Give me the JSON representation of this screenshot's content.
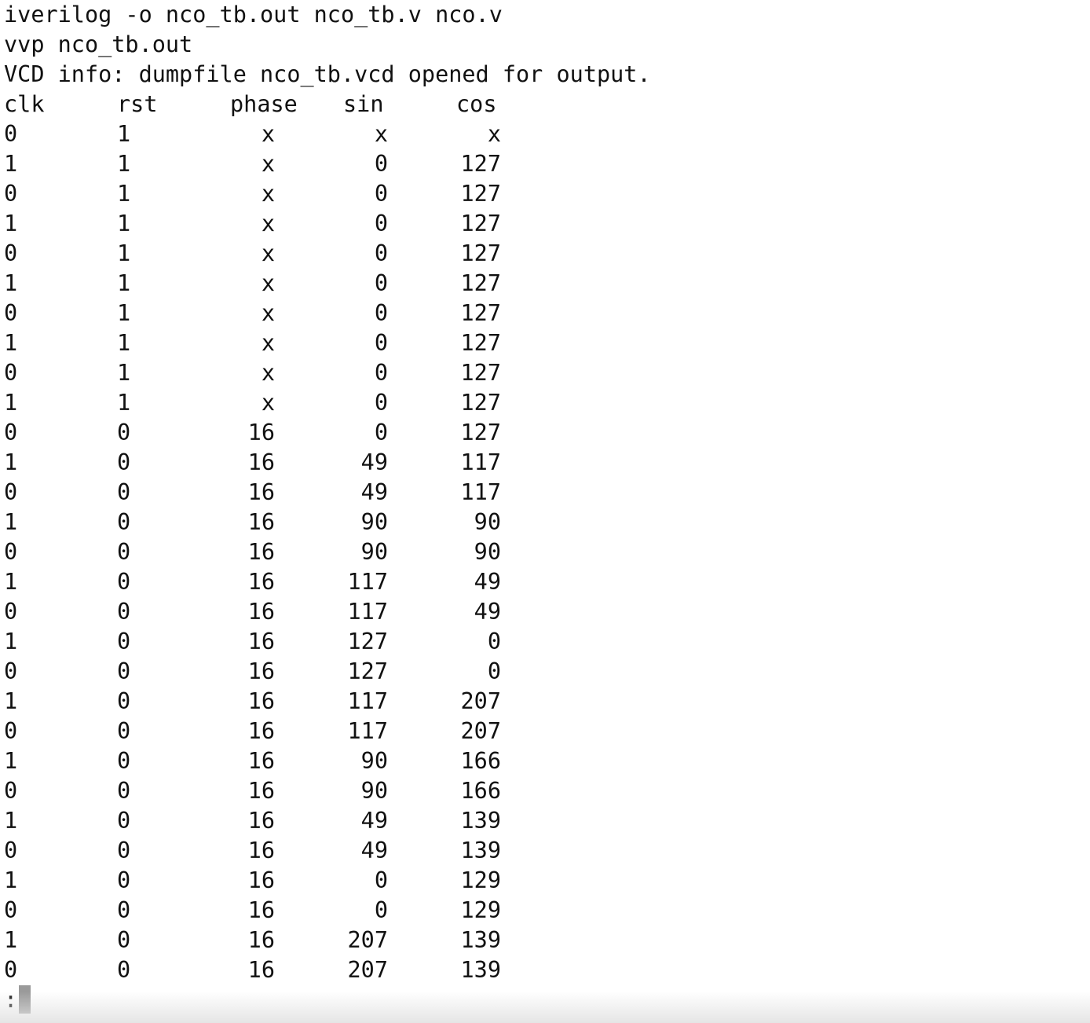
{
  "terminal": {
    "command_lines": [
      "iverilog -o nco_tb.out nco_tb.v nco.v",
      "vvp nco_tb.out",
      "VCD info: dumpfile nco_tb.vcd opened for output."
    ],
    "table": {
      "headers": [
        "clk",
        "rst",
        "phase",
        "sin",
        "cos"
      ],
      "rows": [
        [
          "0",
          "1",
          "x",
          "x",
          "x"
        ],
        [
          "1",
          "1",
          "x",
          "0",
          "127"
        ],
        [
          "0",
          "1",
          "x",
          "0",
          "127"
        ],
        [
          "1",
          "1",
          "x",
          "0",
          "127"
        ],
        [
          "0",
          "1",
          "x",
          "0",
          "127"
        ],
        [
          "1",
          "1",
          "x",
          "0",
          "127"
        ],
        [
          "0",
          "1",
          "x",
          "0",
          "127"
        ],
        [
          "1",
          "1",
          "x",
          "0",
          "127"
        ],
        [
          "0",
          "1",
          "x",
          "0",
          "127"
        ],
        [
          "1",
          "1",
          "x",
          "0",
          "127"
        ],
        [
          "0",
          "0",
          "16",
          "0",
          "127"
        ],
        [
          "1",
          "0",
          "16",
          "49",
          "117"
        ],
        [
          "0",
          "0",
          "16",
          "49",
          "117"
        ],
        [
          "1",
          "0",
          "16",
          "90",
          "90"
        ],
        [
          "0",
          "0",
          "16",
          "90",
          "90"
        ],
        [
          "1",
          "0",
          "16",
          "117",
          "49"
        ],
        [
          "0",
          "0",
          "16",
          "117",
          "49"
        ],
        [
          "1",
          "0",
          "16",
          "127",
          "0"
        ],
        [
          "0",
          "0",
          "16",
          "127",
          "0"
        ],
        [
          "1",
          "0",
          "16",
          "117",
          "207"
        ],
        [
          "0",
          "0",
          "16",
          "117",
          "207"
        ],
        [
          "1",
          "0",
          "16",
          "90",
          "166"
        ],
        [
          "0",
          "0",
          "16",
          "90",
          "166"
        ],
        [
          "1",
          "0",
          "16",
          "49",
          "139"
        ],
        [
          "0",
          "0",
          "16",
          "49",
          "139"
        ],
        [
          "1",
          "0",
          "16",
          "0",
          "129"
        ],
        [
          "0",
          "0",
          "16",
          "0",
          "129"
        ],
        [
          "1",
          "0",
          "16",
          "207",
          "139"
        ],
        [
          "0",
          "0",
          "16",
          "207",
          "139"
        ]
      ]
    },
    "prompt": ":"
  },
  "colors": {
    "background": "#ffffff",
    "text": "#111111",
    "cursor": "#9a9a9a"
  }
}
